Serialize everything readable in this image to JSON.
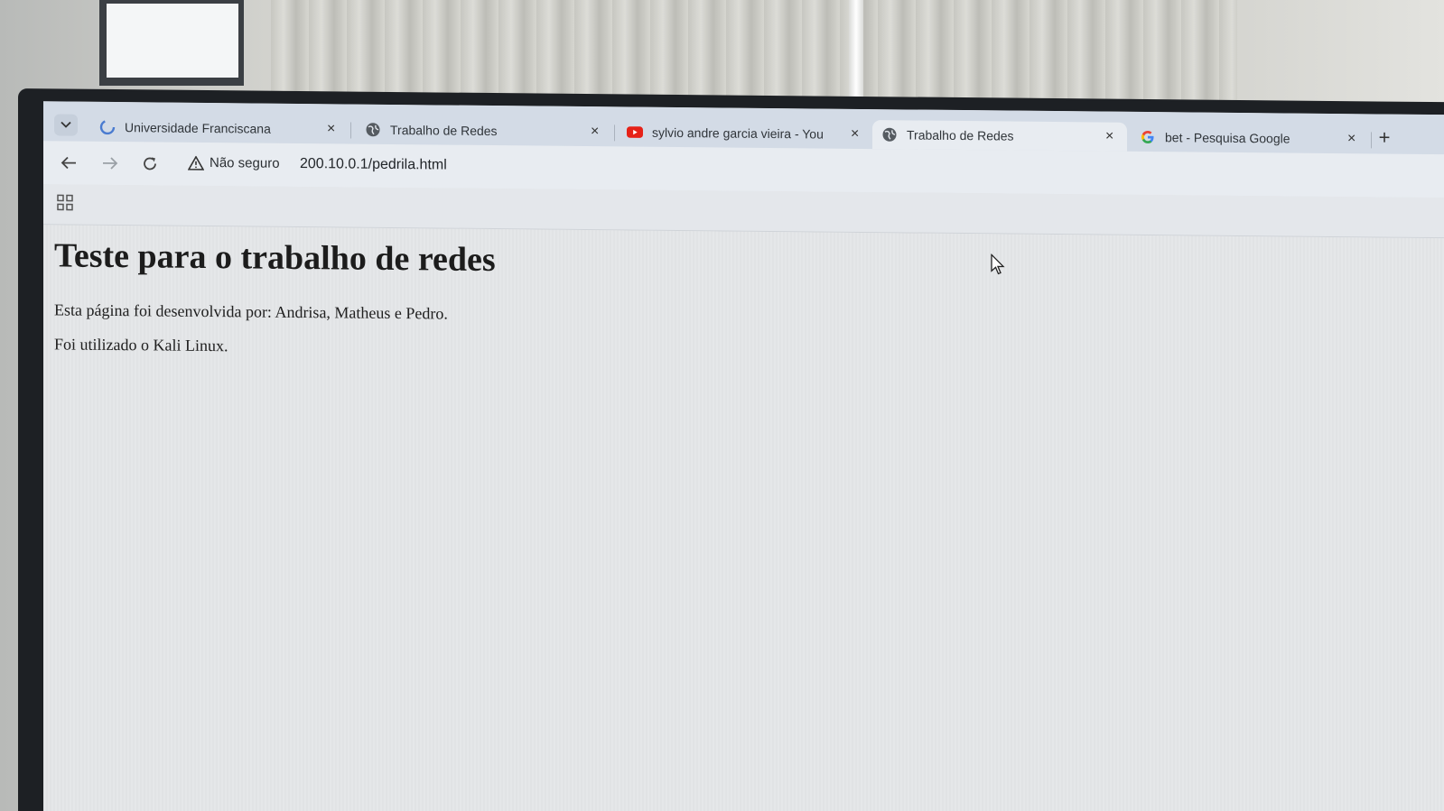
{
  "browser": {
    "tabs": [
      {
        "title": "Universidade Franciscana",
        "icon": "loading-icon",
        "active": false
      },
      {
        "title": "Trabalho de Redes",
        "icon": "globe-icon",
        "active": false
      },
      {
        "title": "sylvio andre garcia vieira - You",
        "icon": "youtube-icon",
        "active": false
      },
      {
        "title": "Trabalho de Redes",
        "icon": "globe-icon",
        "active": true
      },
      {
        "title": "bet - Pesquisa Google",
        "icon": "google-icon",
        "active": false
      }
    ],
    "new_tab_label": "+",
    "close_label": "×",
    "security_label": "Não seguro",
    "url": "200.10.0.1/pedrila.html"
  },
  "page": {
    "heading": "Teste para o trabalho de redes",
    "paragraph_1": "Esta página foi desenvolvida por: Andrisa, Matheus e Pedro.",
    "paragraph_2": "Foi utilizado o Kali Linux."
  },
  "colors": {
    "tabstrip": "#d3dbe6",
    "active_tab": "#e8ecf1",
    "youtube_red": "#e62117",
    "google_blue": "#4285f4"
  }
}
